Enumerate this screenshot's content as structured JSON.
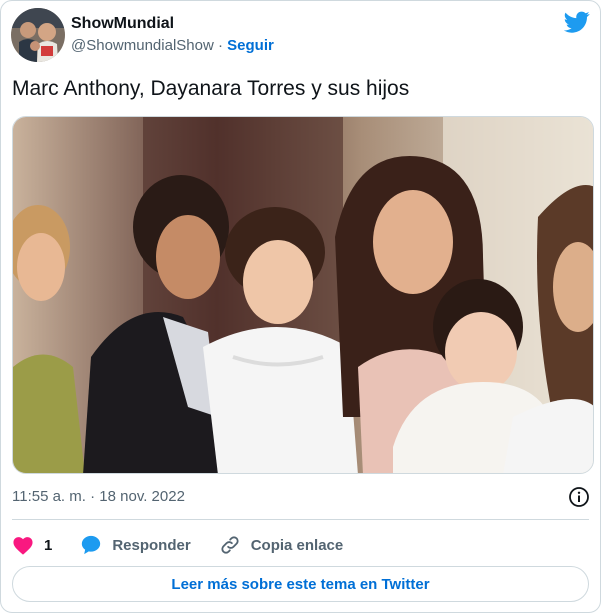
{
  "author": {
    "display_name": "ShowMundial",
    "handle": "@ShowmundialShow",
    "separator": "·",
    "follow_label": "Seguir"
  },
  "tweet": {
    "text": "Marc Anthony, Dayanara Torres y sus hijos",
    "time": "11:55 a. m.",
    "date": "18 nov. 2022",
    "meta_separator": "·"
  },
  "actions": {
    "like_count": "1",
    "reply_label": "Responder",
    "copy_link_label": "Copia enlace"
  },
  "footer": {
    "read_more_label": "Leer más sobre este tema en Twitter"
  },
  "colors": {
    "accent": "#1d9bf0",
    "link": "#006fd6",
    "like": "#f91880",
    "muted": "#536471"
  },
  "icons": [
    "twitter-bird-icon",
    "info-icon",
    "heart-icon",
    "reply-bubble-icon",
    "link-icon"
  ]
}
